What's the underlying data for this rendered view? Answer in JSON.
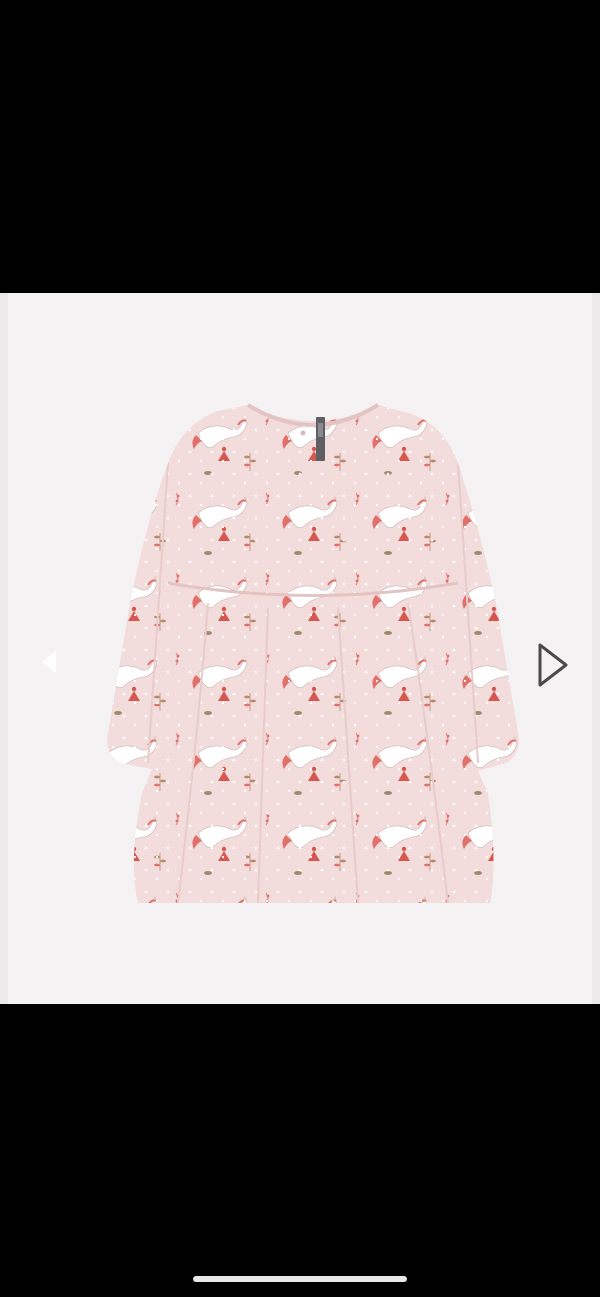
{
  "viewer": {
    "image_subject": "dress-photo",
    "background_color": "#f2f0f1",
    "dress_color": "#f3dcdc",
    "print_accent_color": "#e0706a",
    "leaf_color": "#b98a6a",
    "prev_icon": "chevron-left-icon",
    "next_icon": "play-right-outline-icon"
  },
  "home_indicator": {
    "color": "#e8e8e8"
  }
}
